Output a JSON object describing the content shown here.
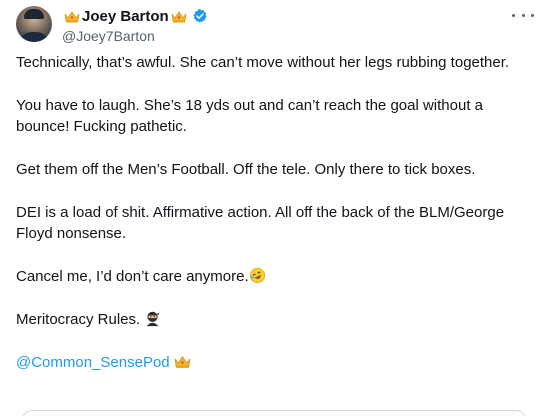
{
  "author": {
    "display_name": "Joey Barton",
    "handle": "@Joey7Barton",
    "verified": true,
    "badge_icons": [
      "crown-icon",
      "crown-icon"
    ],
    "verified_color": "#1d9bf0"
  },
  "tweet": {
    "paragraphs": [
      "Technically, that’s awful. She can’t move without her legs rubbing together.",
      "You have to laugh. She’s 18 yds out and can’t reach the goal without a bounce! Fucking pathetic.",
      "Get them off the Men’s Football. Off the tele. Only there to tick boxes.",
      "DEI is a load of shit. Affirmative action. All off the back of the BLM/George Floyd nonsense.",
      "Cancel me, I’d don’t care anymore.",
      "Meritocracy Rules."
    ],
    "mention": "@Common_SensePod",
    "emojis": [
      "rolling-laughing-emoji",
      "ninja-emoji",
      "crown-icon"
    ],
    "mention_color": "#1d9bf0"
  },
  "menu": {
    "icon": "more-options-icon"
  }
}
